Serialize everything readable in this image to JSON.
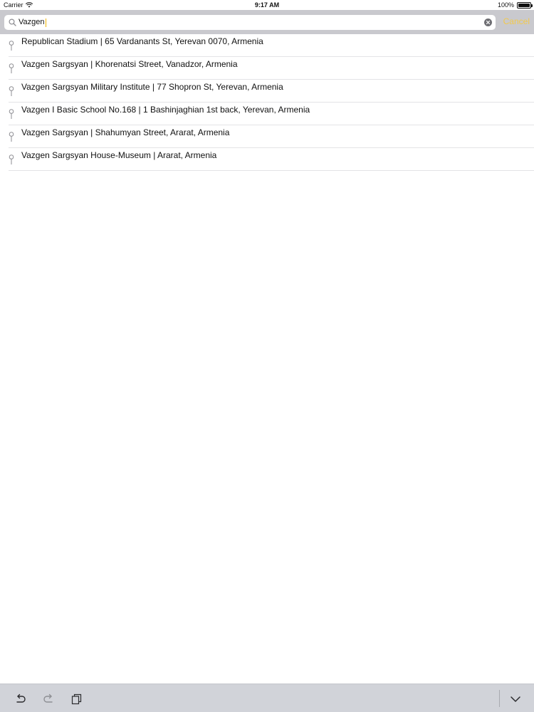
{
  "status_bar": {
    "carrier": "Carrier",
    "time": "9:17 AM",
    "battery": "100%",
    "battery_level": 1.0
  },
  "search": {
    "value": "Vazgen",
    "cancel_label": "Cancel",
    "accent_color": "#f2c94c"
  },
  "results": [
    {
      "text": "Republican Stadium | 65 Vardanants St, Yerevan 0070, Armenia",
      "icon": "pin-icon"
    },
    {
      "text": "Vazgen Sargsyan | Khorenatsi Street, Vanadzor, Armenia",
      "icon": "pin-icon"
    },
    {
      "text": "Vazgen Sargsyan Military Institute | 77 Shopron St, Yerevan, Armenia",
      "icon": "pin-icon"
    },
    {
      "text": "Vazgen I Basic School No.168 | 1 Bashinjaghian 1st back, Yerevan, Armenia",
      "icon": "pin-icon"
    },
    {
      "text": "Vazgen Sargsyan | Shahumyan Street, Ararat, Armenia",
      "icon": "pin-icon"
    },
    {
      "text": "Vazgen Sargsyan House-Museum | Ararat, Armenia",
      "icon": "pin-icon"
    }
  ],
  "toolbar": {
    "buttons": [
      "undo-icon",
      "redo-icon",
      "paste-icon",
      "chevron-down-icon"
    ]
  }
}
